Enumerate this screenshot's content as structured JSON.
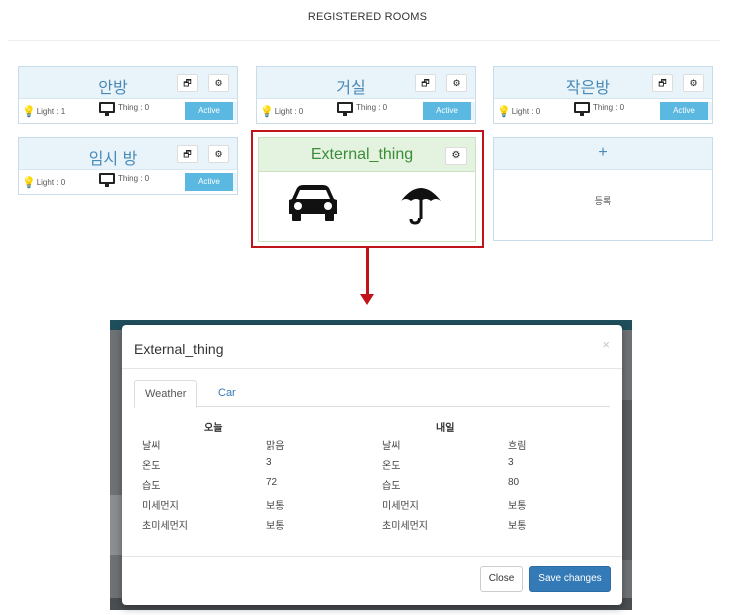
{
  "page": {
    "title": "REGISTERED ROOMS"
  },
  "rooms": [
    {
      "name": "안방",
      "light": "Light : 1",
      "thing": "Thing : 0",
      "status": "Active"
    },
    {
      "name": "거실",
      "light": "Light : 0",
      "thing": "Thing : 0",
      "status": "Active"
    },
    {
      "name": "작은방",
      "light": "Light : 0",
      "thing": "Thing : 0",
      "status": "Active"
    },
    {
      "name": "임시 방",
      "light": "Light : 0",
      "thing": "Thing : 0",
      "status": "Active"
    }
  ],
  "external_card": {
    "title": "External_thing",
    "icons": [
      "car-icon",
      "umbrella-icon"
    ]
  },
  "add_card": {
    "plus": "+",
    "label": "등록"
  },
  "modal": {
    "title": "External_thing",
    "close_glyph": "×",
    "tabs": [
      {
        "label": "Weather"
      },
      {
        "label": "Car"
      }
    ],
    "today_header": "오늘",
    "tomorrow_header": "내일",
    "rows": [
      {
        "label": "날씨",
        "today": "맑음",
        "label2": "날씨",
        "tomorrow": "흐림"
      },
      {
        "label": "온도",
        "today": "3",
        "label2": "온도",
        "tomorrow": "3"
      },
      {
        "label": "습도",
        "today": "72",
        "label2": "습도",
        "tomorrow": "80"
      },
      {
        "label": "미세먼지",
        "today": "보통",
        "label2": "미세먼지",
        "tomorrow": "보통"
      },
      {
        "label": "초미세먼지",
        "today": "보통",
        "label2": "초미세먼지",
        "tomorrow": "보통"
      }
    ],
    "close_label": "Close",
    "save_label": "Save changes"
  },
  "colors": {
    "highlight": "#c0141a",
    "accent": "#337ab7",
    "room_header": "#e8f3fa",
    "external_header": "#e4f3df"
  }
}
